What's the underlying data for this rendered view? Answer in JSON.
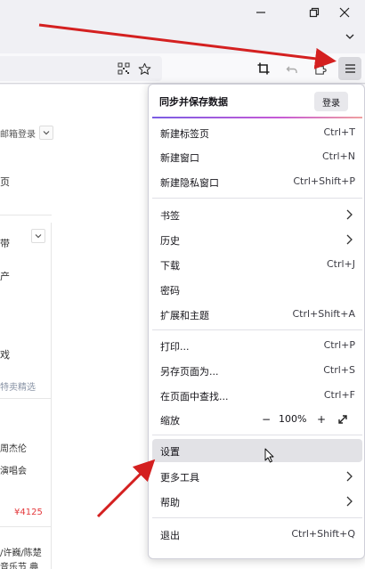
{
  "window": {
    "minimize_icon": "minimize-icon",
    "restore_icon": "restore-icon",
    "close_icon": "close-icon",
    "tab_list_icon": "chevron-down-icon"
  },
  "toolbar": {
    "icons": [
      "qr-code-icon",
      "star-icon",
      "crop-icon",
      "undo-icon",
      "extensions-icon",
      "hamburger-menu-icon"
    ]
  },
  "page": {
    "login_label": "邮箱登录",
    "text_ye": "页",
    "text_chan": "产",
    "text_xi": "戏",
    "text_hot": "特卖精选",
    "text_jay": "周杰伦",
    "text_concert": "演唱会",
    "price": "¥4125",
    "text_names": "/许巍/陈楚",
    "text_bottom": "音乐节 典",
    "text_dai": "带"
  },
  "menu": {
    "header_title": "同步并保存数据",
    "signin_label": "登录",
    "items": [
      {
        "label": "新建标签页",
        "shortcut": "Ctrl+T"
      },
      {
        "label": "新建窗口",
        "shortcut": "Ctrl+N"
      },
      {
        "label": "新建隐私窗口",
        "shortcut": "Ctrl+Shift+P"
      },
      {
        "label": "书签",
        "shortcut": ""
      },
      {
        "label": "历史",
        "shortcut": ""
      },
      {
        "label": "下载",
        "shortcut": "Ctrl+J"
      },
      {
        "label": "密码",
        "shortcut": ""
      },
      {
        "label": "扩展和主题",
        "shortcut": "Ctrl+Shift+A"
      },
      {
        "label": "打印...",
        "shortcut": "Ctrl+P"
      },
      {
        "label": "另存页面为...",
        "shortcut": "Ctrl+S"
      },
      {
        "label": "在页面中查找...",
        "shortcut": "Ctrl+F"
      },
      {
        "label": "缩放",
        "shortcut": ""
      },
      {
        "label": "设置",
        "shortcut": ""
      },
      {
        "label": "更多工具",
        "shortcut": ""
      },
      {
        "label": "帮助",
        "shortcut": ""
      },
      {
        "label": "退出",
        "shortcut": "Ctrl+Shift+Q"
      }
    ],
    "zoom": {
      "minus": "−",
      "value": "100%",
      "plus": "+"
    }
  },
  "colors": {
    "accent_arrow": "#d42020",
    "menu_hover": "#e2e2e6"
  }
}
